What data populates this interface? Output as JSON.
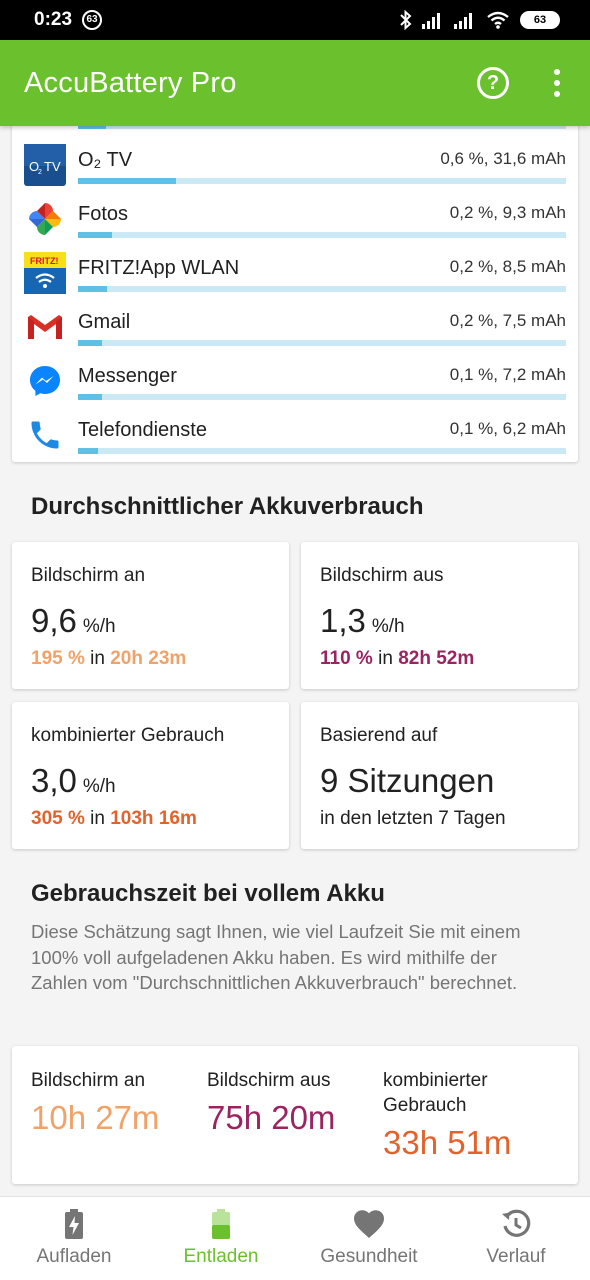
{
  "status_bar": {
    "time": "0:23",
    "notification_count": "63",
    "battery": "63"
  },
  "app_bar": {
    "title": "AccuBattery Pro",
    "help_icon": "help-circle-icon",
    "menu_icon": "more-vert-icon"
  },
  "app_usage": [
    {
      "name": "O₂ TV",
      "stat": "0,6 %, 31,6 mAh",
      "share": 0.2,
      "icon": "o2-tv-icon"
    },
    {
      "name": "Fotos",
      "stat": "0,2 %, 9,3 mAh",
      "share": 0.07,
      "icon": "pinwheel-icon"
    },
    {
      "name": "FRITZ!App WLAN",
      "stat": "0,2 %, 8,5 mAh",
      "share": 0.06,
      "icon": "fritz-wlan-icon"
    },
    {
      "name": "Gmail",
      "stat": "0,2 %, 7,5 mAh",
      "share": 0.05,
      "icon": "gmail-icon"
    },
    {
      "name": "Messenger",
      "stat": "0,1 %, 7,2 mAh",
      "share": 0.05,
      "icon": "messenger-icon"
    },
    {
      "name": "Telefondienste",
      "stat": "0,1 %, 6,2 mAh",
      "share": 0.04,
      "icon": "phone-icon"
    }
  ],
  "avg_usage": {
    "title": "Durchschnittlicher Akkuverbrauch",
    "screen_on": {
      "label": "Bildschirm an",
      "value": "9,6",
      "unit": "%/h",
      "percent": "195 %",
      "in_word": "in",
      "duration": "20h 23m",
      "color": "#f0a269"
    },
    "screen_off": {
      "label": "Bildschirm aus",
      "value": "1,3",
      "unit": "%/h",
      "percent": "110 %",
      "in_word": "in",
      "duration": "82h 52m",
      "color": "#9b2360"
    },
    "combined": {
      "label": "kombinierter Gebrauch",
      "value": "3,0",
      "unit": "%/h",
      "percent": "305 %",
      "in_word": "in",
      "duration": "103h 16m",
      "color": "#e2622c"
    },
    "based_on": {
      "label": "Basierend auf",
      "value": "9 Sitzungen",
      "detail": "in den letzten 7 Tagen"
    }
  },
  "full_charge": {
    "title": "Gebrauchszeit bei vollem Akku",
    "description": "Diese Schätzung sagt Ihnen, wie viel Laufzeit Sie mit einem 100% voll aufgeladenen Akku haben. Es wird mithilfe der Zahlen vom \"Durchschnittlichen Akkuverbrauch\" berechnet.",
    "screen_on": {
      "label": "Bildschirm an",
      "value": "10h 27m",
      "color": "#f0a269"
    },
    "screen_off": {
      "label": "Bildschirm aus",
      "value": "75h 20m",
      "color": "#9b2360"
    },
    "combined": {
      "label_line1": "kombinierter",
      "label_line2": "Gebrauch",
      "value": "33h 51m",
      "color": "#e2622c"
    }
  },
  "bottom_nav": [
    {
      "label": "Aufladen",
      "icon": "battery-charging-icon",
      "active": false
    },
    {
      "label": "Entladen",
      "icon": "battery-discharging-icon",
      "active": true
    },
    {
      "label": "Gesundheit",
      "icon": "heart-icon",
      "active": false
    },
    {
      "label": "Verlauf",
      "icon": "history-icon",
      "active": false
    }
  ],
  "colors": {
    "accent": "#6ac12d",
    "bar": "#5ec0e4",
    "bar_track": "#cbe9f5"
  }
}
